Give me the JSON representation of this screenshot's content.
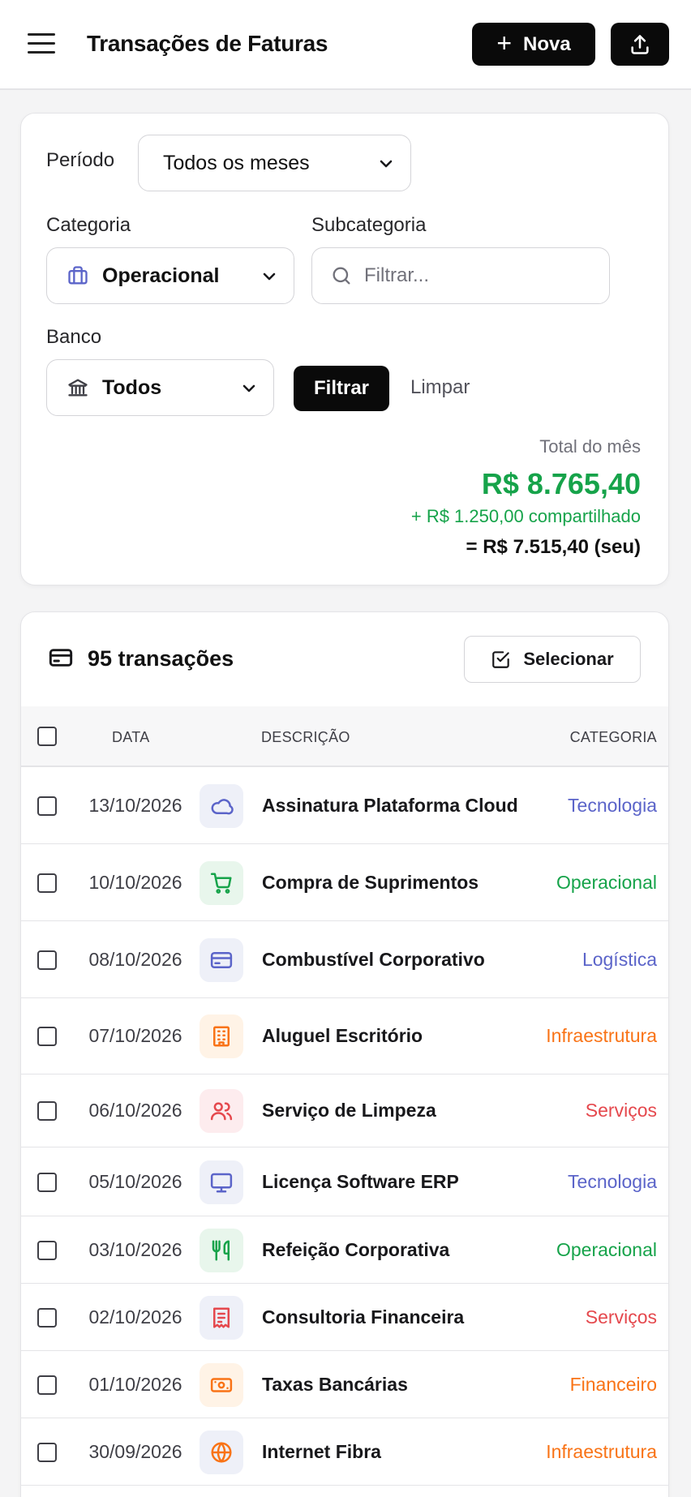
{
  "header": {
    "title": "Transações de Faturas",
    "new_label": "Nova"
  },
  "filters": {
    "period_label": "Período",
    "period_value": "Todos os meses",
    "category_label": "Categoria",
    "category_value": "Operacional",
    "subcategory_label": "Subcategoria",
    "subcategory_placeholder": "Filtrar...",
    "bank_label": "Banco",
    "bank_value": "Todos",
    "filter_button": "Filtrar",
    "clear_button": "Limpar"
  },
  "totals": {
    "label": "Total do mês",
    "value": "R$ 8.765,40",
    "shared": "+ R$ 1.250,00 compartilhado",
    "own": "= R$ 7.515,40 (seu)"
  },
  "list": {
    "count_title": "95 transações",
    "select_button": "Selecionar",
    "columns": [
      "DATA",
      "DESCRIÇÃO",
      "CATEGORIA"
    ],
    "rows": [
      {
        "date": "13/10/2026",
        "icon": "cloud-icon",
        "description": "Assinatura Plataforma Cloud",
        "category": "Tecnologia",
        "color": "#5b64c9",
        "bg": "#eef0f8"
      },
      {
        "date": "10/10/2026",
        "icon": "cart-icon",
        "description": "Compra de Suprimentos",
        "category": "Operacional",
        "color": "#16a34a",
        "bg": "#e8f6ec"
      },
      {
        "date": "08/10/2026",
        "icon": "credit-card-icon",
        "description": "Combustível Corporativo",
        "category": "Logística",
        "color": "#5b64c9",
        "bg": "#eef0f8"
      },
      {
        "date": "07/10/2026",
        "icon": "building-icon",
        "description": "Aluguel Escritório",
        "category": "Infraestrutura",
        "color": "#f97316",
        "bg": "#fff3e6"
      },
      {
        "date": "06/10/2026",
        "icon": "users-icon",
        "description": "Serviço de Limpeza",
        "category": "Serviços",
        "color": "#e5484d",
        "bg": "#fdecee"
      },
      {
        "date": "05/10/2026",
        "icon": "monitor-icon",
        "description": "Licença Software ERP",
        "category": "Tecnologia",
        "color": "#5b64c9",
        "bg": "#eef0f8"
      },
      {
        "date": "03/10/2026",
        "icon": "utensils-icon",
        "description": "Refeição Corporativa",
        "category": "Operacional",
        "color": "#16a34a",
        "bg": "#e8f6ec"
      },
      {
        "date": "02/10/2026",
        "icon": "receipt-icon",
        "description": "Consultoria Financeira",
        "category": "Serviços",
        "color": "#e5484d",
        "bg": "#eef0f8"
      },
      {
        "date": "01/10/2026",
        "icon": "banknote-icon",
        "description": "Taxas Bancárias",
        "category": "Financeiro",
        "color": "#f97316",
        "bg": "#fff3e6"
      },
      {
        "date": "30/09/2026",
        "icon": "globe-icon",
        "description": "Internet Fibra",
        "category": "Infraestrutura",
        "color": "#f97316",
        "bg": "#eef0f8"
      }
    ]
  }
}
